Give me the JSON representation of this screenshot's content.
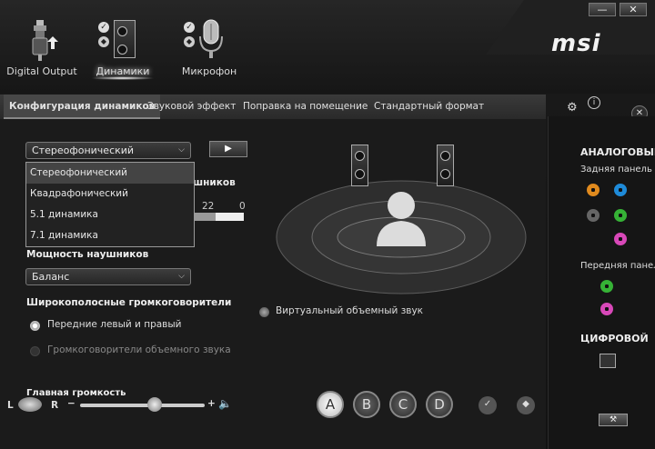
{
  "window": {
    "minimize": "—",
    "close": "✕",
    "brand": "msi"
  },
  "device_tabs": [
    {
      "label": "Digital Output"
    },
    {
      "label": "Динамики"
    },
    {
      "label": "Микрофон"
    }
  ],
  "tabs": [
    {
      "label": "Конфигурация динамиков"
    },
    {
      "label": "Звуковой эффект"
    },
    {
      "label": "Поправка на помещение"
    },
    {
      "label": "Стандартный формат"
    }
  ],
  "config": {
    "selected": "Стереофонический",
    "options": [
      "Стереофонический",
      "Квадрафонический",
      "5.1 динамика",
      "7.1 динамика"
    ],
    "play_label": "▶",
    "hidden_label_fragment": "шников",
    "value_22": "22",
    "value_0": "0"
  },
  "headphones": {
    "label": "Мощность наушников",
    "selected": "Баланс"
  },
  "wideband": {
    "label": "Широкополосные громкоговорители",
    "options": [
      "Передние левый и правый",
      "Громкоговорители объемного звука"
    ],
    "selected_index": 0
  },
  "virtual_surround": {
    "label": "Виртуальный объемный звук"
  },
  "volume": {
    "label": "Главная громкость",
    "left": "L",
    "right": "R",
    "minus": "−",
    "plus": "+",
    "level": 0.6,
    "balance": 0.5
  },
  "presets": [
    "A",
    "B",
    "C",
    "D"
  ],
  "side": {
    "analog": "АНАЛОГОВЫЙ",
    "rear": "Задняя панель",
    "front": "Передняя панель",
    "digital": "ЦИФРОВОЙ",
    "colors": {
      "orange": "#e08a1e",
      "blue": "#1e8ad8",
      "grey": "#666666",
      "green": "#36b236",
      "pink": "#d848b8"
    }
  }
}
